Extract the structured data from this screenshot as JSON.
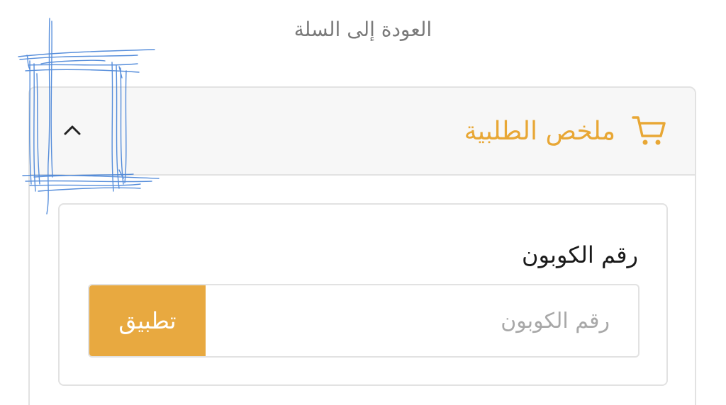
{
  "back_link": {
    "label": "العودة إلى السلة"
  },
  "order_summary": {
    "title": "ملخص الطلبية",
    "expanded": true,
    "icon": "cart-icon",
    "toggle_icon": "chevron-up-icon"
  },
  "coupon": {
    "label": "رقم الكوبون",
    "placeholder": "رقم الكوبون",
    "value": "",
    "apply_label": "تطبيق"
  },
  "colors": {
    "accent": "#e8a735",
    "button": "#e8a940",
    "border": "#e2e2e2",
    "header_bg": "#f7f7f7",
    "muted_text": "#7a7a7a",
    "annotation": "#3a7bd5"
  }
}
